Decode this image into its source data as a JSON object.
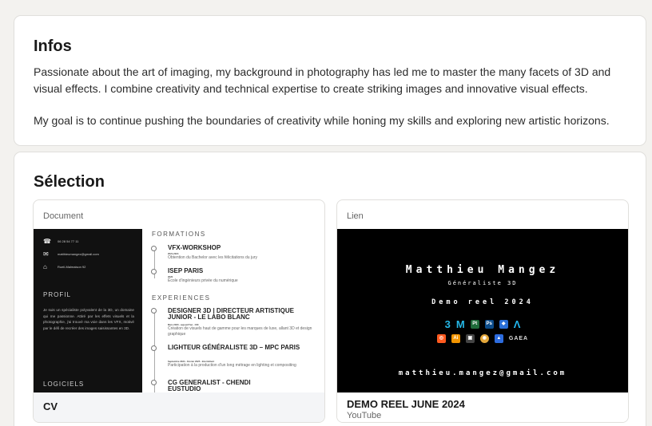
{
  "infos": {
    "title": "Infos",
    "paragraph_1": "Passionate about the art of imaging, my background in photography has led me to master the many facets of 3D and visual effects. I combine creativity and technical expertise to create striking images and innovative visual effects.",
    "paragraph_2": "My goal is to continue pushing the boundaries of creativity while honing my skills and exploring new artistic horizons."
  },
  "selection": {
    "title": "Sélection",
    "items": [
      {
        "tag": "Document",
        "title": "CV",
        "cv": {
          "contacts": [
            "06 28 54 77 11",
            "matthieumangez@gmail.com",
            "Rueil-Malmaison 92"
          ],
          "profil_heading": "PROFIL",
          "profil_text": "Je suis un spécialiste polyvalent de la 3D, un domaine qui me passionne. Attiré par les effets visuels et la photographie, j'ai trouvé ma voie dans les VFX, motivé par le défi de recréer des images saisissantes en 3D.",
          "logiciels_heading": "LOGICIELS",
          "formations_heading": "FORMATIONS",
          "formations": [
            {
              "title": "VFX-WORKSHOP",
              "date": "2021-2024",
              "sub": "Obtention du Bachelor avec les félicitations du jury"
            },
            {
              "title": "ISEP PARIS",
              "date": "2020",
              "sub": "École d'ingénieurs privée du numérique"
            }
          ],
          "experiences_heading": "EXPERIENCES",
          "experiences": [
            {
              "title": "DESIGNER 3D | DIRECTEUR ARTISTIQUE JUNIOR - LE LABO BLANC",
              "date": "Mars 2020 - aujourd'hui · CDI",
              "sub": "Création de visuels haut de gamme pour les marques de luxe, allant 3D et design graphique"
            },
            {
              "title": "LIGHTEUR GÉNÉRALISTE 3D – MPC PARIS",
              "date": "Septembre 2024 - Février 2025 · Intermittent",
              "sub": "Participation à la production d'un long métrage en lighting et compositing"
            },
            {
              "title": "CG GENERALIST - CHENDI EUSTUDIO",
              "date": "",
              "sub": ""
            }
          ]
        }
      },
      {
        "tag": "Lien",
        "title": "DEMO REEL JUNE 2024",
        "subtitle": "YouTube",
        "reel": {
          "name": "Matthieu Mangez",
          "role": "Généraliste 3D",
          "demo": "Demo reel 2024",
          "software_row_1": [
            "3",
            "M",
            "Pt",
            "Ps",
            "◆",
            "Λ"
          ],
          "software_row_2": [
            "◎",
            "Ai",
            "▣",
            "◉",
            "▲",
            "GAEA"
          ],
          "email": "matthieu.mangez@gmail.com"
        }
      }
    ]
  },
  "colors": {
    "background": "#f3f2ef",
    "card": "#ffffff",
    "border": "#e0dfdc",
    "reel_bg": "#000000",
    "houdini": "#ff6a00",
    "substance_pt": "#1f6b3a",
    "photoshop": "#2fa3f7"
  }
}
